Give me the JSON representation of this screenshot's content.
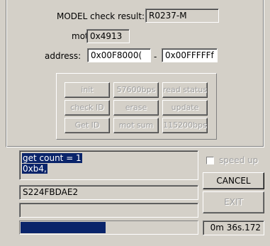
{
  "model": {
    "label": "MODEL check result:",
    "value": "R0237-M"
  },
  "mot": {
    "label": "mot",
    "value": "0x4913"
  },
  "address": {
    "label": "address:",
    "start": "0x00F8000(",
    "separator": "-",
    "end": "0x00FFFFFf"
  },
  "buttons": {
    "init": "init",
    "baud_57600": "57600bps",
    "read_status": "read status",
    "check_id": "check ID",
    "erase": "erase",
    "update": "update",
    "get_id": "Get ID",
    "mot_sum": "mot sum",
    "baud_115200": "115200bps",
    "cancel": "CANCEL",
    "exit": "EXIT"
  },
  "log": {
    "line1": "get count = 1",
    "line2": "0xb4,"
  },
  "speed_up": {
    "label": "speed up",
    "checked": false
  },
  "serial": "S224FBDAE2",
  "status_line": "",
  "progress": {
    "fraction": 0.48
  },
  "timer": "0m 36s.172"
}
